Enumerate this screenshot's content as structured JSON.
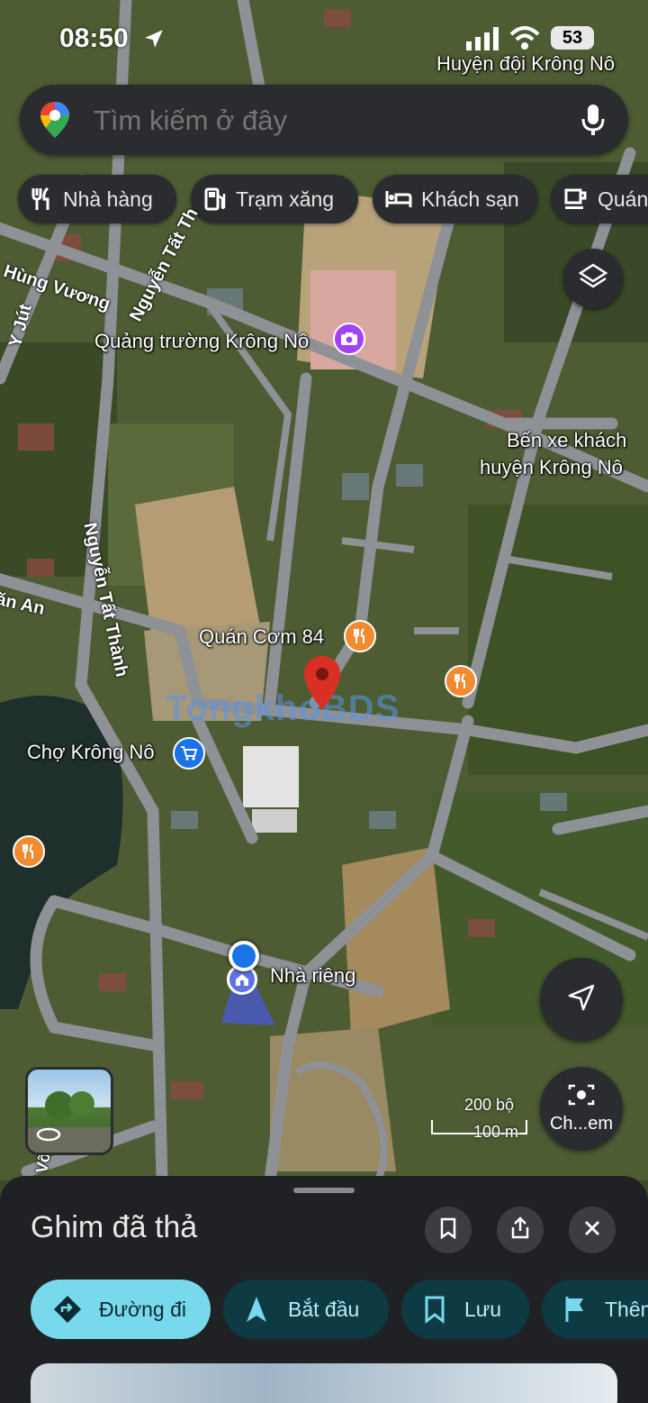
{
  "status": {
    "time": "08:50",
    "battery": "53"
  },
  "search": {
    "placeholder": "Tìm kiếm ở đây"
  },
  "chips": [
    {
      "label": "Nhà hàng",
      "icon": "restaurant-icon"
    },
    {
      "label": "Trạm xăng",
      "icon": "gas-station-icon"
    },
    {
      "label": "Khách sạn",
      "icon": "hotel-icon"
    },
    {
      "label": "Quán",
      "icon": "coffee-icon"
    }
  ],
  "map": {
    "labels": {
      "huyen_doi": "Huyện đội Krông Nô",
      "quang_truong": "Quảng trường Krông Nô",
      "ben_xe_1": "Bến xe khách",
      "ben_xe_2": "huyện Krông Nô",
      "quan_com": "Quán Cơm 84",
      "cho": "Chợ Krông Nô",
      "nha_rieng": "Nhà riêng"
    },
    "roads": {
      "hung_vuong": "Hùng Vương",
      "nguyen_tat_thanh_1": "Nguyễn Tất Th",
      "nguyen_tat_thanh_2": "Nguyễn Tất Thành",
      "y_jut": "Y Jút",
      "an": "ăn An",
      "vo": "Võ"
    },
    "watermark": "TongkhoBDS",
    "scale": {
      "top": "200 bộ",
      "bottom": "100 m"
    },
    "camera_label": "Ch...em"
  },
  "sheet": {
    "title": "Ghim đã thả",
    "buttons": [
      {
        "label": "Đường đi",
        "icon": "directions-icon"
      },
      {
        "label": "Bắt đầu",
        "icon": "navigation-arrow-icon"
      },
      {
        "label": "Lưu",
        "icon": "bookmark-icon"
      },
      {
        "label": "Thêm",
        "icon": "flag-icon"
      }
    ]
  },
  "colors": {
    "accent_teal": "#78d9ec",
    "dark_button": "#0e3a44",
    "pin_red": "#d93025",
    "poi_orange": "#f28b30",
    "poi_blue": "#1a73e8",
    "poi_purple": "#a142f4"
  }
}
